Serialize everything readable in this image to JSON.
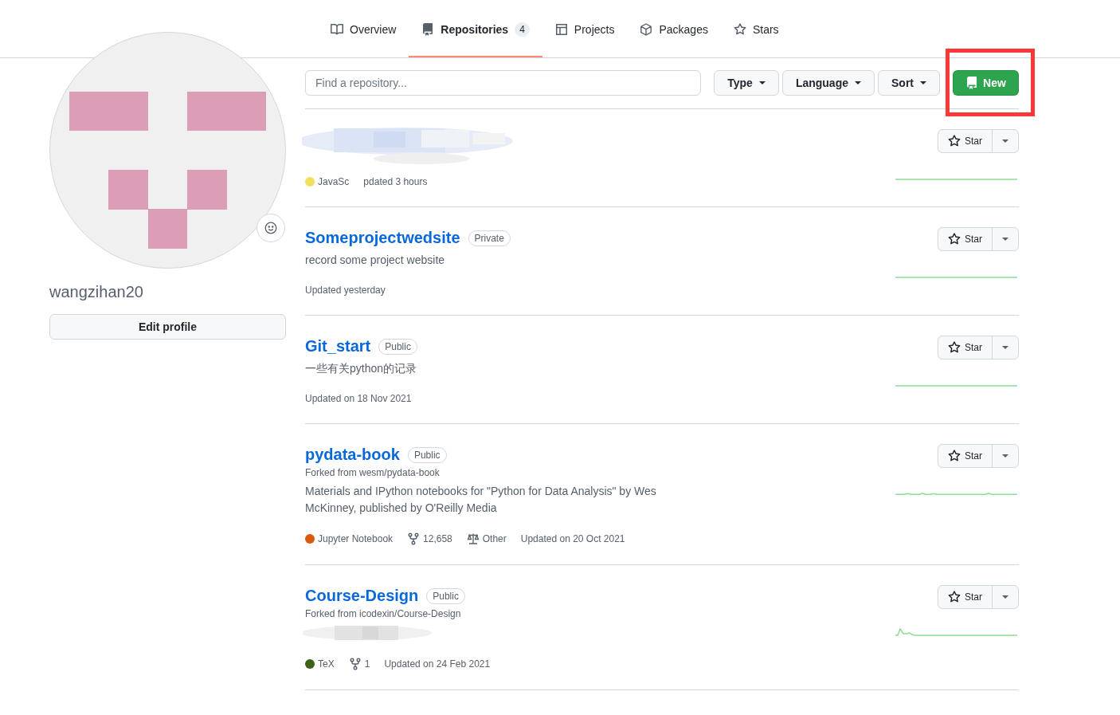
{
  "profile": {
    "username": "wangzihan20",
    "edit_button": "Edit profile"
  },
  "tabs": [
    {
      "label": "Overview",
      "selected": false
    },
    {
      "label": "Repositories",
      "count": "4",
      "selected": true
    },
    {
      "label": "Projects",
      "selected": false
    },
    {
      "label": "Packages",
      "selected": false
    },
    {
      "label": "Stars",
      "selected": false
    }
  ],
  "filter_bar": {
    "search": {
      "placeholder": "Find a repository..."
    },
    "dropdowns": [
      "Type",
      "Language",
      "Sort"
    ],
    "new_button": {
      "label": "New",
      "highlighted": true
    }
  },
  "repositories": [
    {
      "kind": "redacted",
      "language": {
        "name": "JavaSc",
        "color": "#f1e05a"
      },
      "updated": "pdated 3 hours",
      "star_button": "Star"
    },
    {
      "kind": "normal",
      "name": "Someprojectwedsite",
      "visibility": "Private",
      "description": "record some project website",
      "updated": "Updated yesterday",
      "star_button": "Star"
    },
    {
      "kind": "normal",
      "name": "Git_start",
      "visibility": "Public",
      "description": "一些有关python的记录",
      "updated": "Updated on 18 Nov 2021",
      "star_button": "Star"
    },
    {
      "kind": "normal",
      "name": "pydata-book",
      "visibility": "Public",
      "forked_from": "Forked from wesm/pydata-book",
      "description": "Materials and IPython notebooks for \"Python for Data Analysis\" by Wes McKinney, published by O'Reilly Media",
      "language": {
        "name": "Jupyter Notebook",
        "color": "#da5b0b"
      },
      "forks": "12,658",
      "license": "Other",
      "updated": "Updated on 20 Oct 2021",
      "star_button": "Star"
    },
    {
      "kind": "normal",
      "name": "Course-Design",
      "visibility": "Public",
      "forked_from": "Forked from icodexin/Course-Design",
      "description_redacted": true,
      "language": {
        "name": "TeX",
        "color": "#3d6117"
      },
      "forks": "1",
      "updated": "Updated on 24 Feb 2021",
      "star_button": "Star"
    }
  ]
}
